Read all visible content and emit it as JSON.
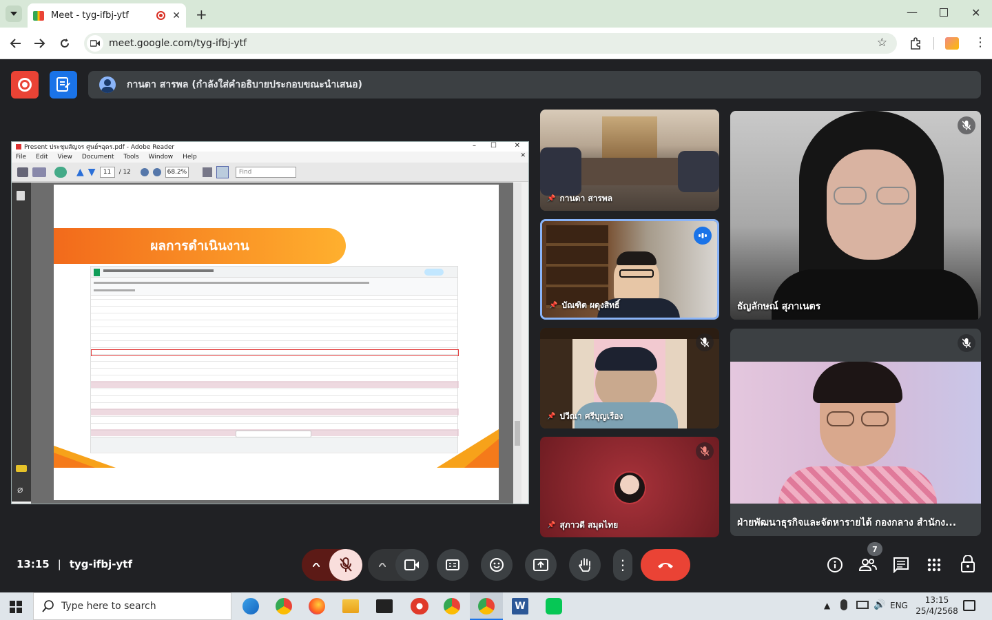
{
  "browser": {
    "tab_title": "Meet - tyg-ifbj-ytf",
    "url": "meet.google.com/tyg-ifbj-ytf"
  },
  "meet": {
    "presenter_label": "กานดา สารพล (กำลังใส่คำอธิบายประกอบขณะนำเสนอ)",
    "time": "13:15",
    "separator": "|",
    "meeting_code": "tyg-ifbj-ytf",
    "people_count": "7",
    "participants": [
      {
        "name": "กานดา สารพล"
      },
      {
        "name": "บัณฑิต ผดุงสิทธิ์"
      },
      {
        "name": "ปวีณา ศรีบุญเรือง"
      },
      {
        "name": "สุภาวดี สมุดไทย"
      },
      {
        "name": "ธัญลักษณ์ สุภาเนตร"
      },
      {
        "name": "ฝ่ายพัฒนาธุรกิจและจัดหารายได้ กองกลาง สำนักง..."
      }
    ]
  },
  "pdf": {
    "title": "Present ประชุมสัญจร ศูนย์ฯอุดร.pdf - Adobe Reader",
    "menu": [
      "File",
      "Edit",
      "View",
      "Document",
      "Tools",
      "Window",
      "Help"
    ],
    "page_current": "11",
    "page_total": "/ 12",
    "zoom": "68.2%",
    "find_placeholder": "Find",
    "slide_heading": "ผลการดำเนินงาน"
  },
  "taskbar": {
    "search_placeholder": "Type here to search",
    "lang": "ENG",
    "clock_time": "13:15",
    "clock_date": "25/4/2568"
  },
  "colors": {
    "accent_red": "#ea4335",
    "meet_blue": "#1a73e8",
    "bg": "#202124"
  }
}
